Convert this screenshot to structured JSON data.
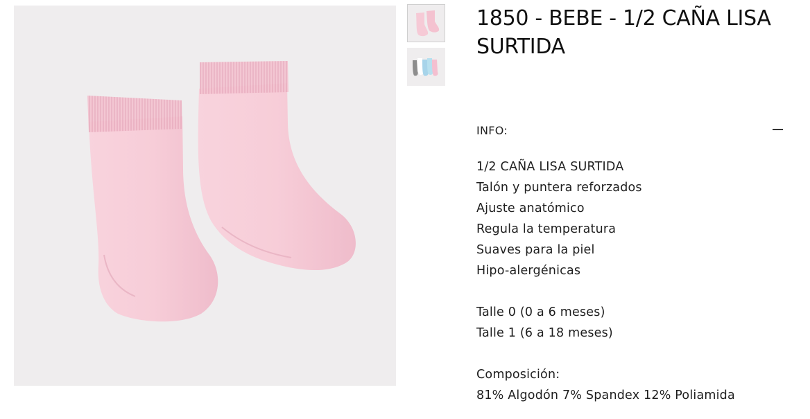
{
  "product": {
    "title_line1": "1850 - BEBE - 1/2 CAÑA LISA",
    "title_line2": "SURTIDA",
    "main_image_icon": "pink-socks-photo",
    "thumbnails": [
      {
        "icon": "pink-socks-thumbnail"
      },
      {
        "icon": "assorted-color-socks-thumbnail"
      }
    ]
  },
  "info": {
    "label": "INFO:",
    "toggle_icon": "minus-icon",
    "features": [
      "1/2 CAÑA LISA SURTIDA",
      "Talón y puntera reforzados",
      "Ajuste anatómico",
      "Regula la temperatura",
      "Suaves para la piel",
      "Hipo-alergénicas"
    ],
    "sizes": [
      "Talle 0 (0 a 6 meses)",
      "Talle 1 (6 a 18 meses)"
    ],
    "composition_label": "Composición:",
    "composition_value": "81% Algodón 7% Spandex 12% Poliamida"
  },
  "colors": {
    "image_bg": "#efedee",
    "sock_pink": "#f6cad6",
    "text": "#1a1a1a"
  }
}
